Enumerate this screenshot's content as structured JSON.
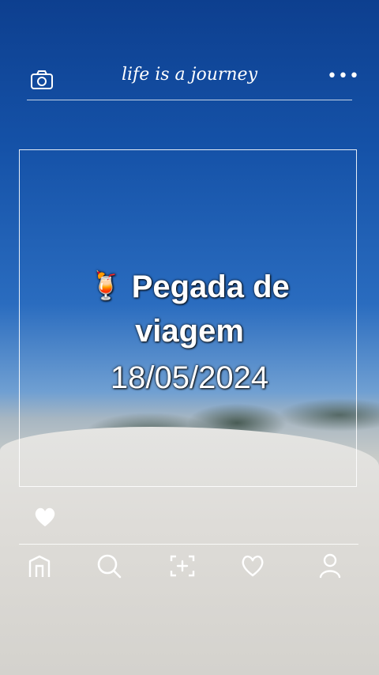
{
  "header": {
    "brand_text": "life is a journey",
    "camera_icon": "camera-icon",
    "more_icon": "more-horizontal-icon",
    "more_glyph": "•••"
  },
  "card": {
    "emoji": "🍹",
    "title_line1": "Pegada de",
    "title_line2": "viagem",
    "date": "18/05/2024"
  },
  "like_icon": "heart-filled-icon",
  "nav": {
    "items": [
      {
        "icon": "home-icon"
      },
      {
        "icon": "search-icon"
      },
      {
        "icon": "add-photo-icon"
      },
      {
        "icon": "heart-icon"
      },
      {
        "icon": "profile-icon"
      }
    ]
  },
  "colors": {
    "sky": "#1552a8",
    "sand": "#dedcd8",
    "line": "#ffffff"
  }
}
